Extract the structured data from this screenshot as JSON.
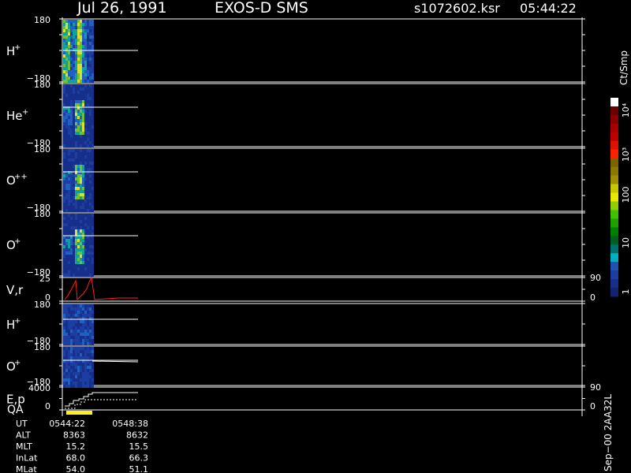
{
  "header": {
    "date": "Jul 26, 1991",
    "instrument": "EXOS-D SMS",
    "file": "s1072602.ksr",
    "time": "05:44:22"
  },
  "panels": [
    {
      "label": "H",
      "sup": "+",
      "ymax": "180",
      "ymin": "−180"
    },
    {
      "label": "He",
      "sup": "+",
      "ymax": "180",
      "ymin": "−180"
    },
    {
      "label": "O",
      "sup": "++",
      "ymax": "180",
      "ymin": "−180"
    },
    {
      "label": "O",
      "sup": "+",
      "ymax": "180",
      "ymin": "−180"
    },
    {
      "label": "V,r",
      "sup": "",
      "ymax": "25",
      "ymin": "0",
      "rmax": "90",
      "rmin": "0"
    },
    {
      "label": "H",
      "sup": "+",
      "ymax": "180",
      "ymin": "−180"
    },
    {
      "label": "O",
      "sup": "+",
      "ymax": "180",
      "ymin": "−180"
    },
    {
      "label": "E,p",
      "sup": "",
      "ymax": "4000",
      "ymin": "0",
      "rmax": "90",
      "rmin": "0"
    }
  ],
  "qa_label": "QA",
  "colorbar": {
    "unit": "Ct/Smp",
    "labels": [
      "10⁴",
      "10³",
      "100",
      "10",
      "1"
    ],
    "colors": [
      "#ffffff",
      "#6b0000",
      "#8a0000",
      "#a80000",
      "#c00000",
      "#e01000",
      "#ff2000",
      "#7a6400",
      "#8c7800",
      "#a09000",
      "#c8c800",
      "#e8e800",
      "#90d000",
      "#40c000",
      "#20a000",
      "#008000",
      "#006020",
      "#007070",
      "#00b0c0",
      "#2050b0",
      "#1c3ea0",
      "#152f8a",
      "#102470"
    ]
  },
  "footer": {
    "rows": [
      {
        "name": "UT",
        "v1": "0544:22",
        "v2": "0548:38"
      },
      {
        "name": "ALT",
        "v1": "8363",
        "v2": "8632"
      },
      {
        "name": "MLT",
        "v1": "15.2",
        "v2": "15.5"
      },
      {
        "name": "InLat",
        "v1": "68.0",
        "v2": "66.3"
      },
      {
        "name": "MLat",
        "v1": "54.0",
        "v2": "51.1"
      }
    ],
    "side_text": "Sep−00 2AA32L"
  },
  "chart_data": {
    "type": "heatmap",
    "title": "Jul 26, 1991  EXOS-D SMS",
    "x_range_ut": [
      "0544:22",
      "0548:38"
    ],
    "ylim_pitch": [
      -180,
      180
    ],
    "velocity_panel": {
      "ylim": [
        0,
        25
      ],
      "right_ylim": [
        0,
        90
      ]
    },
    "energy_panel": {
      "ylim": [
        0,
        4000
      ],
      "right_ylim": [
        0,
        90
      ]
    },
    "color_scale": "log",
    "color_range_counts": [
      1,
      10000
    ]
  }
}
